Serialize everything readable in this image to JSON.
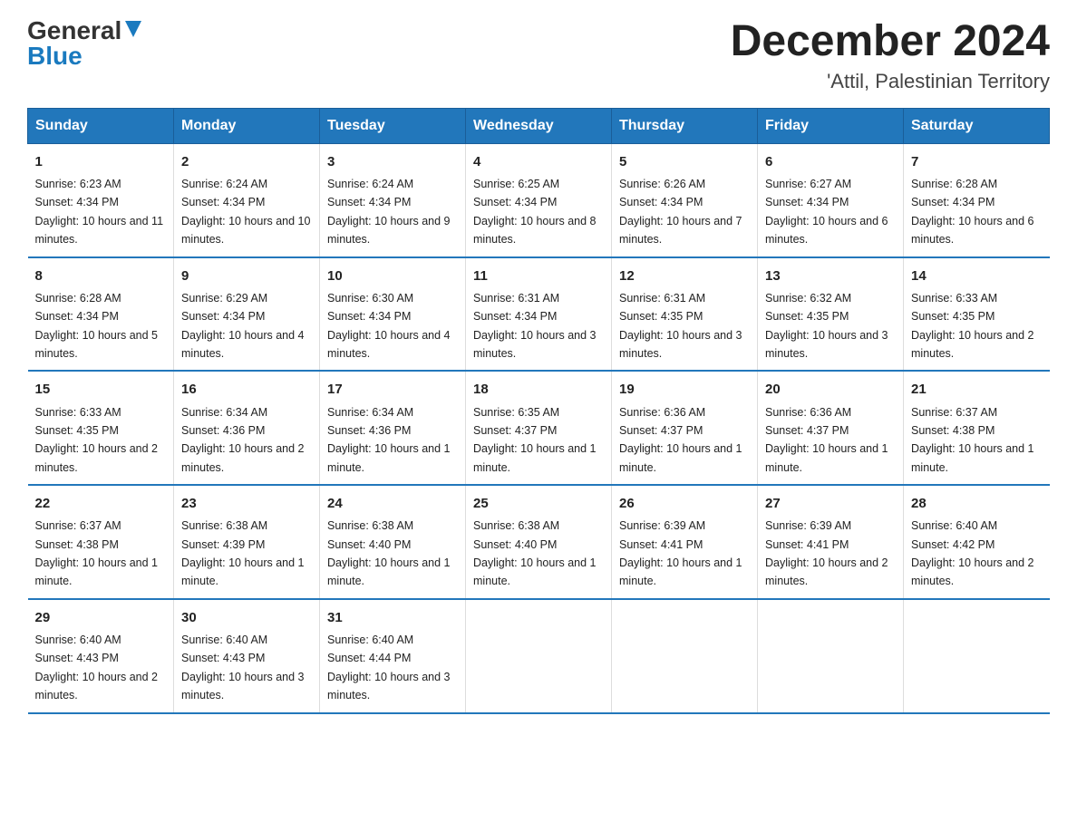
{
  "header": {
    "logo_general": "General",
    "logo_blue": "Blue",
    "month_title": "December 2024",
    "location": "'Attil, Palestinian Territory"
  },
  "days_of_week": [
    "Sunday",
    "Monday",
    "Tuesday",
    "Wednesday",
    "Thursday",
    "Friday",
    "Saturday"
  ],
  "weeks": [
    [
      {
        "day": "1",
        "sunrise": "Sunrise: 6:23 AM",
        "sunset": "Sunset: 4:34 PM",
        "daylight": "Daylight: 10 hours and 11 minutes."
      },
      {
        "day": "2",
        "sunrise": "Sunrise: 6:24 AM",
        "sunset": "Sunset: 4:34 PM",
        "daylight": "Daylight: 10 hours and 10 minutes."
      },
      {
        "day": "3",
        "sunrise": "Sunrise: 6:24 AM",
        "sunset": "Sunset: 4:34 PM",
        "daylight": "Daylight: 10 hours and 9 minutes."
      },
      {
        "day": "4",
        "sunrise": "Sunrise: 6:25 AM",
        "sunset": "Sunset: 4:34 PM",
        "daylight": "Daylight: 10 hours and 8 minutes."
      },
      {
        "day": "5",
        "sunrise": "Sunrise: 6:26 AM",
        "sunset": "Sunset: 4:34 PM",
        "daylight": "Daylight: 10 hours and 7 minutes."
      },
      {
        "day": "6",
        "sunrise": "Sunrise: 6:27 AM",
        "sunset": "Sunset: 4:34 PM",
        "daylight": "Daylight: 10 hours and 6 minutes."
      },
      {
        "day": "7",
        "sunrise": "Sunrise: 6:28 AM",
        "sunset": "Sunset: 4:34 PM",
        "daylight": "Daylight: 10 hours and 6 minutes."
      }
    ],
    [
      {
        "day": "8",
        "sunrise": "Sunrise: 6:28 AM",
        "sunset": "Sunset: 4:34 PM",
        "daylight": "Daylight: 10 hours and 5 minutes."
      },
      {
        "day": "9",
        "sunrise": "Sunrise: 6:29 AM",
        "sunset": "Sunset: 4:34 PM",
        "daylight": "Daylight: 10 hours and 4 minutes."
      },
      {
        "day": "10",
        "sunrise": "Sunrise: 6:30 AM",
        "sunset": "Sunset: 4:34 PM",
        "daylight": "Daylight: 10 hours and 4 minutes."
      },
      {
        "day": "11",
        "sunrise": "Sunrise: 6:31 AM",
        "sunset": "Sunset: 4:34 PM",
        "daylight": "Daylight: 10 hours and 3 minutes."
      },
      {
        "day": "12",
        "sunrise": "Sunrise: 6:31 AM",
        "sunset": "Sunset: 4:35 PM",
        "daylight": "Daylight: 10 hours and 3 minutes."
      },
      {
        "day": "13",
        "sunrise": "Sunrise: 6:32 AM",
        "sunset": "Sunset: 4:35 PM",
        "daylight": "Daylight: 10 hours and 3 minutes."
      },
      {
        "day": "14",
        "sunrise": "Sunrise: 6:33 AM",
        "sunset": "Sunset: 4:35 PM",
        "daylight": "Daylight: 10 hours and 2 minutes."
      }
    ],
    [
      {
        "day": "15",
        "sunrise": "Sunrise: 6:33 AM",
        "sunset": "Sunset: 4:35 PM",
        "daylight": "Daylight: 10 hours and 2 minutes."
      },
      {
        "day": "16",
        "sunrise": "Sunrise: 6:34 AM",
        "sunset": "Sunset: 4:36 PM",
        "daylight": "Daylight: 10 hours and 2 minutes."
      },
      {
        "day": "17",
        "sunrise": "Sunrise: 6:34 AM",
        "sunset": "Sunset: 4:36 PM",
        "daylight": "Daylight: 10 hours and 1 minute."
      },
      {
        "day": "18",
        "sunrise": "Sunrise: 6:35 AM",
        "sunset": "Sunset: 4:37 PM",
        "daylight": "Daylight: 10 hours and 1 minute."
      },
      {
        "day": "19",
        "sunrise": "Sunrise: 6:36 AM",
        "sunset": "Sunset: 4:37 PM",
        "daylight": "Daylight: 10 hours and 1 minute."
      },
      {
        "day": "20",
        "sunrise": "Sunrise: 6:36 AM",
        "sunset": "Sunset: 4:37 PM",
        "daylight": "Daylight: 10 hours and 1 minute."
      },
      {
        "day": "21",
        "sunrise": "Sunrise: 6:37 AM",
        "sunset": "Sunset: 4:38 PM",
        "daylight": "Daylight: 10 hours and 1 minute."
      }
    ],
    [
      {
        "day": "22",
        "sunrise": "Sunrise: 6:37 AM",
        "sunset": "Sunset: 4:38 PM",
        "daylight": "Daylight: 10 hours and 1 minute."
      },
      {
        "day": "23",
        "sunrise": "Sunrise: 6:38 AM",
        "sunset": "Sunset: 4:39 PM",
        "daylight": "Daylight: 10 hours and 1 minute."
      },
      {
        "day": "24",
        "sunrise": "Sunrise: 6:38 AM",
        "sunset": "Sunset: 4:40 PM",
        "daylight": "Daylight: 10 hours and 1 minute."
      },
      {
        "day": "25",
        "sunrise": "Sunrise: 6:38 AM",
        "sunset": "Sunset: 4:40 PM",
        "daylight": "Daylight: 10 hours and 1 minute."
      },
      {
        "day": "26",
        "sunrise": "Sunrise: 6:39 AM",
        "sunset": "Sunset: 4:41 PM",
        "daylight": "Daylight: 10 hours and 1 minute."
      },
      {
        "day": "27",
        "sunrise": "Sunrise: 6:39 AM",
        "sunset": "Sunset: 4:41 PM",
        "daylight": "Daylight: 10 hours and 2 minutes."
      },
      {
        "day": "28",
        "sunrise": "Sunrise: 6:40 AM",
        "sunset": "Sunset: 4:42 PM",
        "daylight": "Daylight: 10 hours and 2 minutes."
      }
    ],
    [
      {
        "day": "29",
        "sunrise": "Sunrise: 6:40 AM",
        "sunset": "Sunset: 4:43 PM",
        "daylight": "Daylight: 10 hours and 2 minutes."
      },
      {
        "day": "30",
        "sunrise": "Sunrise: 6:40 AM",
        "sunset": "Sunset: 4:43 PM",
        "daylight": "Daylight: 10 hours and 3 minutes."
      },
      {
        "day": "31",
        "sunrise": "Sunrise: 6:40 AM",
        "sunset": "Sunset: 4:44 PM",
        "daylight": "Daylight: 10 hours and 3 minutes."
      },
      {
        "day": "",
        "sunrise": "",
        "sunset": "",
        "daylight": ""
      },
      {
        "day": "",
        "sunrise": "",
        "sunset": "",
        "daylight": ""
      },
      {
        "day": "",
        "sunrise": "",
        "sunset": "",
        "daylight": ""
      },
      {
        "day": "",
        "sunrise": "",
        "sunset": "",
        "daylight": ""
      }
    ]
  ]
}
